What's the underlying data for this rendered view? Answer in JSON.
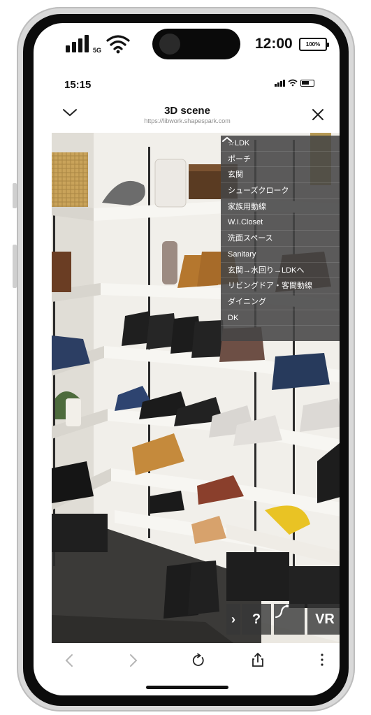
{
  "status_bar": {
    "network": "5G",
    "time": "12:00",
    "battery": "100%"
  },
  "browser_status": {
    "time": "15:15"
  },
  "header": {
    "title": "3D scene",
    "url": "https://libwork.shapespark.com"
  },
  "menu": {
    "items": [
      {
        "label": "☆LDK"
      },
      {
        "label": "ポーチ"
      },
      {
        "label": "玄関"
      },
      {
        "label": "シューズクローク"
      },
      {
        "label": "家族用動線"
      },
      {
        "label": "W.I.Closet"
      },
      {
        "label": "洗面スペース"
      },
      {
        "label": "Sanitary"
      },
      {
        "label": "玄関→水回り→LDKへ"
      },
      {
        "label": "リビングドア・客間動線"
      },
      {
        "label": "ダイニング"
      },
      {
        "label": "DK"
      }
    ]
  },
  "viewer_controls": {
    "expand": "›",
    "help": "?",
    "vr": "VR"
  },
  "toolbar": {
    "icons": [
      "back-icon",
      "forward-icon",
      "reload-icon",
      "share-icon",
      "more-icon"
    ]
  }
}
